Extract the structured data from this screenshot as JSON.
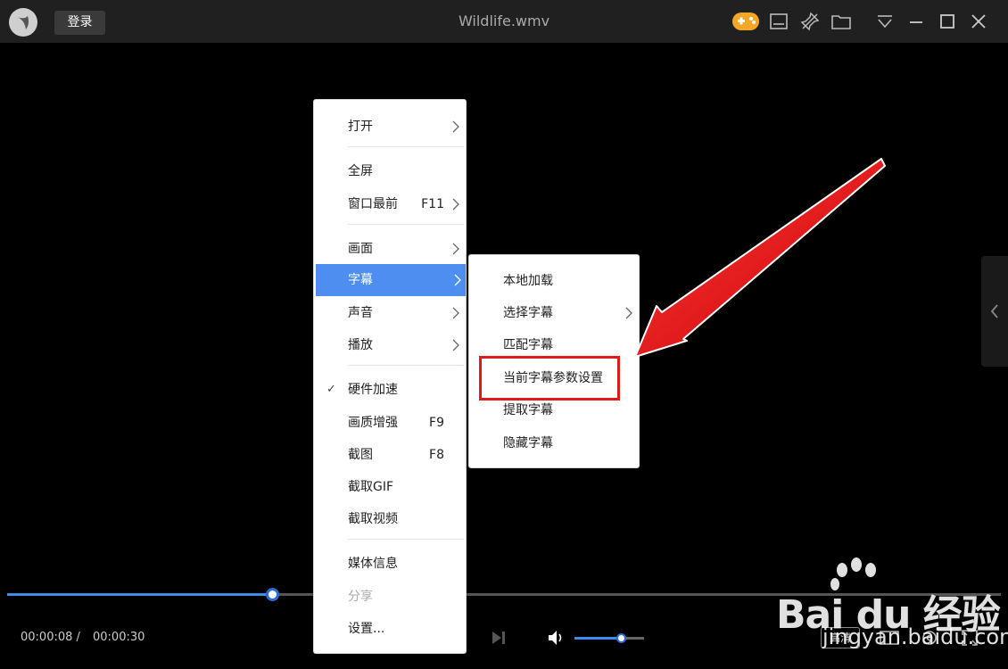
{
  "window": {
    "title": "Wildlife.wmv",
    "login_label": "登录"
  },
  "playback": {
    "current_time": "00:00:08 /",
    "total_time": "00:00:30",
    "progress": 0.267,
    "volume": 0.67,
    "quality_label": "高清"
  },
  "context_menu": {
    "items": [
      {
        "label": "打开",
        "has_submenu": true
      },
      {
        "label": "全屏"
      },
      {
        "label": "窗口最前",
        "shortcut": "F11",
        "has_submenu": true
      },
      {
        "label": "画面",
        "has_submenu": true
      },
      {
        "label": "字幕",
        "has_submenu": true,
        "highlighted": true
      },
      {
        "label": "声音",
        "has_submenu": true
      },
      {
        "label": "播放",
        "has_submenu": true
      },
      {
        "label": "硬件加速",
        "checked": true
      },
      {
        "label": "画质增强",
        "shortcut": "F9"
      },
      {
        "label": "截图",
        "shortcut": "F8"
      },
      {
        "label": "截取GIF"
      },
      {
        "label": "截取视频"
      },
      {
        "label": "媒体信息"
      },
      {
        "label": "分享",
        "disabled": true
      },
      {
        "label": "设置..."
      }
    ]
  },
  "subtitle_menu": {
    "items": [
      {
        "label": "本地加载"
      },
      {
        "label": "选择字幕",
        "has_submenu": true
      },
      {
        "label": "匹配字幕"
      },
      {
        "label": "当前字幕参数设置",
        "annotated": true
      },
      {
        "label": "提取字幕"
      },
      {
        "label": "隐藏字幕"
      }
    ]
  },
  "watermark": {
    "logo_text": "Bai du 经验",
    "url": "jingyan.baidu.com"
  },
  "colors": {
    "accent": "#3a8eea",
    "highlight": "#4e8ef0",
    "annotation_red": "#e01a1a",
    "game_icon": "#f5a623"
  },
  "icons": {
    "game": "gamepad-icon",
    "subtitle": "subtitle-icon",
    "pin": "pin-icon",
    "folder": "folder-icon",
    "menu": "dropdown-menu-icon",
    "minimize": "minimize-icon",
    "maximize": "maximize-icon",
    "close": "close-icon"
  }
}
